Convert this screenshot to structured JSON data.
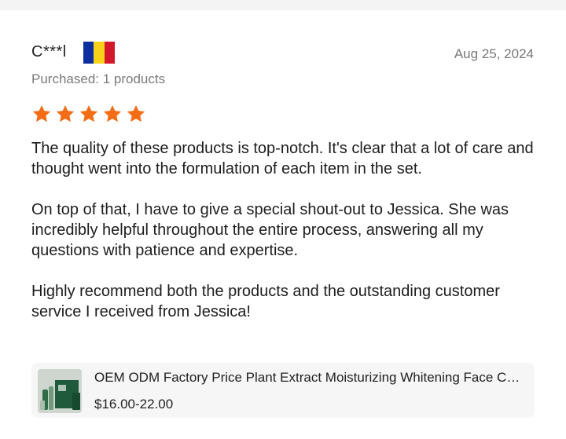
{
  "review": {
    "reviewer": "C***l",
    "country_flag": {
      "name": "romania-flag",
      "colors": [
        "#0b2fa0",
        "#f6d21b",
        "#d3182c"
      ]
    },
    "date": "Aug 25, 2024",
    "purchased": "Purchased: 1 products",
    "rating": 5,
    "rating_max": 5,
    "star_color": "#f46d16",
    "paragraphs": [
      "The quality of these products is top-notch. It's clear that a lot of care and thought went into the formulation of each item in the set.",
      "On top of that, I have to give a special shout-out to Jessica. She was incredibly helpful throughout the entire process, answering all my questions with patience and expertise.",
      "Highly recommend both the products and the outstanding customer service I received from Jessica!"
    ]
  },
  "product": {
    "title": "OEM ODM Factory Price Plant Extract Moisturizing Whitening Face Care Set",
    "price": "$16.00-22.00",
    "thumbnail_icon": "skincare-set-thumbnail"
  }
}
